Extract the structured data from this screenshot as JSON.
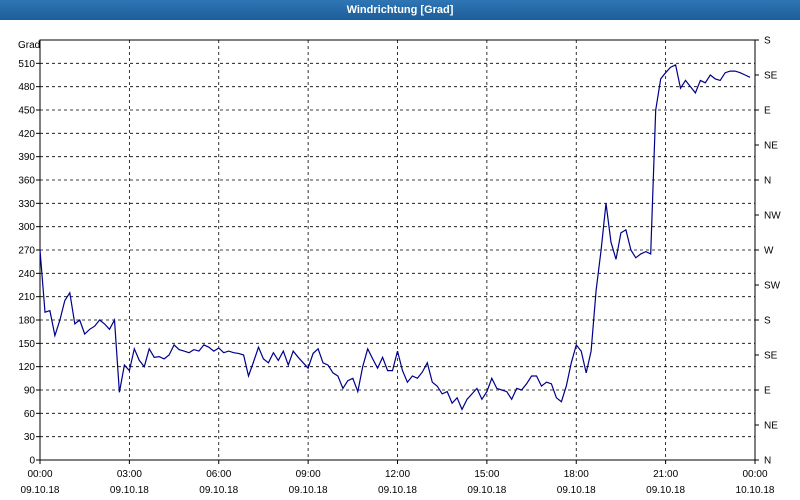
{
  "window": {
    "title": "Windrichtung [Grad]"
  },
  "colors": {
    "titlebar": "#1d5d99",
    "line": "#00008b",
    "grid": "#000000"
  },
  "chart_data": {
    "type": "line",
    "title": "Windrichtung [Grad]",
    "ylabel": "Grad",
    "ylim": [
      0,
      540
    ],
    "yticks": [
      0,
      30,
      60,
      90,
      120,
      150,
      180,
      210,
      240,
      270,
      300,
      330,
      360,
      390,
      420,
      450,
      480,
      510
    ],
    "right_axis": [
      {
        "value": 0,
        "label": "N"
      },
      {
        "value": 45,
        "label": "NE"
      },
      {
        "value": 90,
        "label": "E"
      },
      {
        "value": 135,
        "label": "SE"
      },
      {
        "value": 180,
        "label": "S"
      },
      {
        "value": 225,
        "label": "SW"
      },
      {
        "value": 270,
        "label": "W"
      },
      {
        "value": 315,
        "label": "NW"
      },
      {
        "value": 360,
        "label": "N"
      },
      {
        "value": 405,
        "label": "NE"
      },
      {
        "value": 450,
        "label": "E"
      },
      {
        "value": 495,
        "label": "SE"
      },
      {
        "value": 540,
        "label": "S"
      }
    ],
    "xlim": [
      "2018-10-09 00:00",
      "2018-10-10 00:00"
    ],
    "xticks": [
      {
        "time": "00:00",
        "date": "09.10.18"
      },
      {
        "time": "03:00",
        "date": "09.10.18"
      },
      {
        "time": "06:00",
        "date": "09.10.18"
      },
      {
        "time": "09:00",
        "date": "09.10.18"
      },
      {
        "time": "12:00",
        "date": "09.10.18"
      },
      {
        "time": "15:00",
        "date": "09.10.18"
      },
      {
        "time": "18:00",
        "date": "09.10.18"
      },
      {
        "time": "21:00",
        "date": "09.10.18"
      },
      {
        "time": "00:00",
        "date": "10.10.18"
      }
    ],
    "grid": true,
    "series": [
      {
        "x": [
          "00:00",
          "00:10",
          "00:20",
          "00:30",
          "00:40",
          "00:50",
          "01:00",
          "01:10",
          "01:20",
          "01:30",
          "01:40",
          "01:50",
          "02:00",
          "02:10",
          "02:20",
          "02:30",
          "02:40",
          "02:50",
          "03:00",
          "03:10",
          "03:20",
          "03:30",
          "03:40",
          "03:50",
          "04:00",
          "04:10",
          "04:20",
          "04:30",
          "04:40",
          "04:50",
          "05:00",
          "05:10",
          "05:20",
          "05:30",
          "05:40",
          "05:50",
          "06:00",
          "06:10",
          "06:20",
          "06:30",
          "06:40",
          "06:50",
          "07:00",
          "07:10",
          "07:20",
          "07:30",
          "07:40",
          "07:50",
          "08:00",
          "08:10",
          "08:20",
          "08:30",
          "08:40",
          "08:50",
          "09:00",
          "09:10",
          "09:20",
          "09:30",
          "09:40",
          "09:50",
          "10:00",
          "10:10",
          "10:20",
          "10:30",
          "10:40",
          "10:50",
          "11:00",
          "11:10",
          "11:20",
          "11:30",
          "11:40",
          "11:50",
          "12:00",
          "12:10",
          "12:20",
          "12:30",
          "12:40",
          "12:50",
          "13:00",
          "13:10",
          "13:20",
          "13:30",
          "13:40",
          "13:50",
          "14:00",
          "14:10",
          "14:20",
          "14:30",
          "14:40",
          "14:50",
          "15:00",
          "15:10",
          "15:20",
          "15:30",
          "15:40",
          "15:50",
          "16:00",
          "16:10",
          "16:20",
          "16:30",
          "16:40",
          "16:50",
          "17:00",
          "17:10",
          "17:20",
          "17:30",
          "17:40",
          "17:50",
          "18:00",
          "18:10",
          "18:20",
          "18:30",
          "18:40",
          "18:50",
          "19:00",
          "19:10",
          "19:20",
          "19:30",
          "19:40",
          "19:50",
          "20:00",
          "20:10",
          "20:20",
          "20:30",
          "20:40",
          "20:50",
          "21:00",
          "21:10",
          "21:20",
          "21:30",
          "21:40",
          "21:50",
          "22:00",
          "22:10",
          "22:20",
          "22:30",
          "22:40",
          "22:50",
          "23:00",
          "23:10",
          "23:20",
          "23:30",
          "23:40",
          "23:50"
        ],
        "values": [
          270,
          190,
          192,
          160,
          180,
          205,
          215,
          175,
          180,
          162,
          168,
          172,
          180,
          175,
          168,
          180,
          87,
          122,
          115,
          143,
          128,
          120,
          143,
          132,
          133,
          130,
          135,
          148,
          142,
          140,
          138,
          142,
          140,
          148,
          145,
          140,
          144,
          138,
          140,
          138,
          137,
          135,
          108,
          126,
          145,
          130,
          125,
          138,
          128,
          140,
          122,
          140,
          132,
          125,
          118,
          137,
          143,
          125,
          122,
          112,
          108,
          92,
          102,
          105,
          88,
          120,
          143,
          130,
          118,
          132,
          115,
          115,
          140,
          115,
          100,
          108,
          105,
          113,
          125,
          100,
          95,
          85,
          88,
          73,
          80,
          65,
          78,
          85,
          92,
          78,
          88,
          105,
          92,
          90,
          88,
          78,
          92,
          90,
          98,
          108,
          108,
          95,
          100,
          98,
          80,
          75,
          95,
          125,
          148,
          140,
          112,
          140,
          218,
          270,
          330,
          280,
          258,
          292,
          296,
          270,
          260,
          265,
          268,
          265,
          450,
          490,
          498,
          505,
          508,
          478,
          488,
          480,
          472,
          488,
          485,
          495,
          490,
          488,
          498,
          500,
          500,
          498,
          495,
          492
        ]
      }
    ]
  }
}
